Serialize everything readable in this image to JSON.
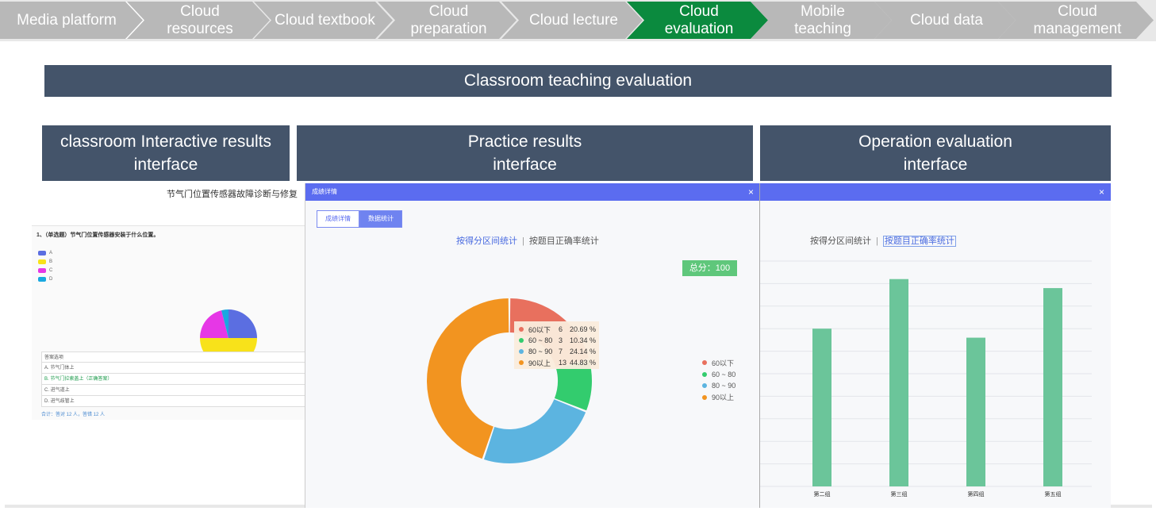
{
  "nav": {
    "items": [
      {
        "label": "Media platform",
        "active": false
      },
      {
        "label": "Cloud resources",
        "active": false
      },
      {
        "label": "Cloud textbook",
        "active": false
      },
      {
        "label": "Cloud preparation",
        "active": false
      },
      {
        "label": "Cloud lecture",
        "active": false
      },
      {
        "label": "Cloud evaluation",
        "active": true
      },
      {
        "label": "Mobile teaching",
        "active": false
      },
      {
        "label": "Cloud data",
        "active": false
      },
      {
        "label": "Cloud management",
        "active": false
      }
    ],
    "active_color": "#0b8a3e",
    "inactive_color": "#b8b8b8"
  },
  "banner": "Classroom teaching evaluation",
  "sections": [
    {
      "line1": "classroom Interactive results",
      "line2": "interface"
    },
    {
      "line1": "Practice results",
      "line2": "interface"
    },
    {
      "line1": "Operation evaluation",
      "line2": "interface"
    }
  ],
  "interactive": {
    "title": "节气门位置传感器故障诊断与修复",
    "question": "1、（单选题）节气门位置传感器安装于什么位置。",
    "legend": [
      "A",
      "B",
      "C",
      "D"
    ],
    "options_header": "答案选项",
    "options": [
      "A. 节气门体上",
      "B. 节气门拉索盖上（正确答案）",
      "C. 进气道上",
      "D. 进气歧管上"
    ],
    "summary": "合计：答对 12 人，答错 12 人",
    "chart_data": {
      "type": "pie",
      "categories": [
        "A",
        "B",
        "C",
        "D"
      ],
      "values": [
        25,
        50,
        21,
        4
      ],
      "colors": [
        "#5b6ee1",
        "#f8e21a",
        "#e637e6",
        "#19a8e0"
      ]
    }
  },
  "practice": {
    "dialog_title": "成绩详情",
    "close": "×",
    "tabs": [
      "成绩详情",
      "数据统计"
    ],
    "active_tab": 1,
    "sub_left": "按得分区间统计",
    "sub_sep": "|",
    "sub_right": "按题目正确率统计",
    "score": "总分：100",
    "chart_data": {
      "type": "pie",
      "categories": [
        "60以下",
        "60 ~ 80",
        "80 ~ 90",
        "90以上"
      ],
      "counts": [
        6,
        3,
        7,
        13
      ],
      "values": [
        20.69,
        10.34,
        24.14,
        44.83
      ],
      "colors": [
        "#e8705e",
        "#33cc6e",
        "#5cb4e0",
        "#f29420"
      ],
      "legend_position": "right"
    },
    "tooltip": [
      {
        "range": "60以下",
        "count": "6",
        "pct": "20.69 %"
      },
      {
        "range": "60 ~ 80",
        "count": "3",
        "pct": "10.34 %"
      },
      {
        "range": "80 ~ 90",
        "count": "7",
        "pct": "24.14 %"
      },
      {
        "range": "90以上",
        "count": "13",
        "pct": "44.83 %"
      }
    ]
  },
  "operation": {
    "close": "×",
    "sub_left": "按得分区间统计",
    "sub_sep": "|",
    "sub_right": "按题目正确率统计",
    "chart_data": {
      "type": "bar",
      "categories": [
        "第二组",
        "第三组",
        "第四组",
        "第五组"
      ],
      "values": [
        70,
        92,
        66,
        88
      ],
      "ylim": [
        0,
        100
      ],
      "color": "#6bc59a",
      "grid": true
    }
  }
}
